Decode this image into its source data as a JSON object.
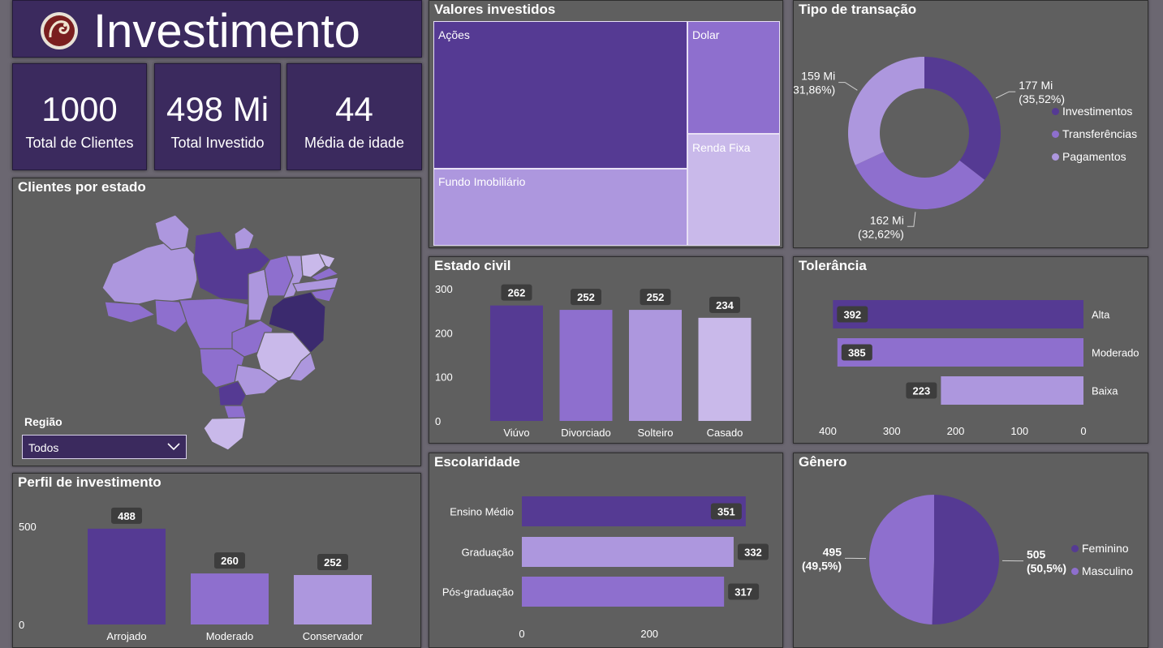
{
  "header": {
    "title": "Investimento",
    "logo_icon": "dragon-emblem-icon"
  },
  "kpis": [
    {
      "value": "1000",
      "label": "Total de Clientes"
    },
    {
      "value": "498 Mi",
      "label": "Total Investido"
    },
    {
      "value": "44",
      "label": "Média de idade"
    }
  ],
  "colors": {
    "dark": "#553a93",
    "mid": "#8e6fce",
    "light": "#ad97de",
    "lighter": "#c9b9ea",
    "panel": "#5f5f5f",
    "header": "#3b2a5e"
  },
  "map": {
    "title": "Clientes por estado",
    "filter_label": "Região",
    "filter_value": "Todos"
  },
  "chart_data": [
    {
      "id": "valores_investidos",
      "type": "treemap",
      "title": "Valores investidos",
      "categories": [
        "Ações",
        "Dolar",
        "Fundo Imobiliário",
        "Renda Fixa"
      ]
    },
    {
      "id": "tipo_transacao",
      "type": "pie",
      "subtype": "donut",
      "title": "Tipo de transação",
      "categories": [
        "Investimentos",
        "Transferências",
        "Pagamentos"
      ],
      "labels": [
        "177 Mi",
        "162 Mi",
        "159 Mi"
      ],
      "percents": [
        "(35,52%)",
        "(32,62%)",
        "(31,86%)"
      ],
      "values": [
        177,
        162,
        159
      ],
      "legend_position": "right"
    },
    {
      "id": "estado_civil",
      "type": "bar",
      "title": "Estado civil",
      "categories": [
        "Viúvo",
        "Divorciado",
        "Solteiro",
        "Casado"
      ],
      "values": [
        262,
        252,
        252,
        234
      ],
      "ylim": [
        0,
        300
      ],
      "yticks": [
        "0",
        "100",
        "200",
        "300"
      ]
    },
    {
      "id": "tolerancia",
      "type": "bar",
      "orientation": "horizontal-reversed",
      "title": "Tolerância",
      "categories": [
        "Alta",
        "Moderado",
        "Baixa"
      ],
      "values": [
        392,
        385,
        223
      ],
      "xlim": [
        0,
        400
      ],
      "xticks": [
        "400",
        "300",
        "200",
        "100",
        "0"
      ]
    },
    {
      "id": "perfil_investimento",
      "type": "bar",
      "title": "Perfil de investimento",
      "categories": [
        "Arrojado",
        "Moderado",
        "Conservador"
      ],
      "values": [
        488,
        260,
        252
      ],
      "ylim": [
        0,
        500
      ],
      "yticks": [
        "0",
        "500"
      ]
    },
    {
      "id": "escolaridade",
      "type": "bar",
      "orientation": "horizontal",
      "title": "Escolaridade",
      "categories": [
        "Ensino Médio",
        "Graduação",
        "Pós-graduação"
      ],
      "values": [
        351,
        332,
        317
      ],
      "xticks": [
        "0",
        "200"
      ]
    },
    {
      "id": "genero",
      "type": "pie",
      "title": "Gênero",
      "categories": [
        "Feminino",
        "Masculino"
      ],
      "labels": [
        "505",
        "495"
      ],
      "percents": [
        "(50,5%)",
        "(49,5%)"
      ],
      "values": [
        505,
        495
      ],
      "legend_position": "right"
    }
  ]
}
